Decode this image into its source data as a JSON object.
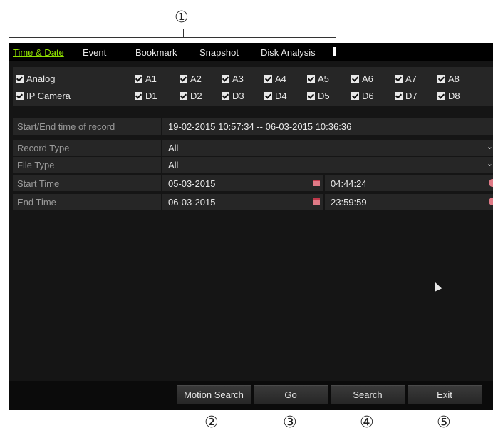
{
  "callouts": [
    "①",
    "②",
    "③",
    "④",
    "⑤"
  ],
  "tabs": [
    {
      "label": "Time & Date",
      "active": true
    },
    {
      "label": "Event"
    },
    {
      "label": "Bookmark"
    },
    {
      "label": "Snapshot"
    },
    {
      "label": "Disk Analysis"
    }
  ],
  "channels": {
    "analog_label": "Analog",
    "ip_label": "IP Camera",
    "analog": [
      "A1",
      "A2",
      "A3",
      "A4",
      "A5",
      "A6",
      "A7",
      "A8"
    ],
    "ip": [
      "D1",
      "D2",
      "D3",
      "D4",
      "D5",
      "D6",
      "D7",
      "D8"
    ]
  },
  "record_range": {
    "label": "Start/End time of record",
    "value": "19-02-2015 10:57:34 -- 06-03-2015 10:36:36"
  },
  "record_type": {
    "label": "Record Type",
    "value": "All"
  },
  "file_type": {
    "label": "File Type",
    "value": "All"
  },
  "start_time": {
    "label": "Start Time",
    "date": "05-03-2015",
    "time": "04:44:24"
  },
  "end_time": {
    "label": "End Time",
    "date": "06-03-2015",
    "time": "23:59:59"
  },
  "buttons": {
    "motion_search": "Motion Search",
    "go": "Go",
    "search": "Search",
    "exit": "Exit"
  },
  "colors": {
    "active_tab": "#8fe000",
    "background": "#151515",
    "row": "#262626"
  }
}
